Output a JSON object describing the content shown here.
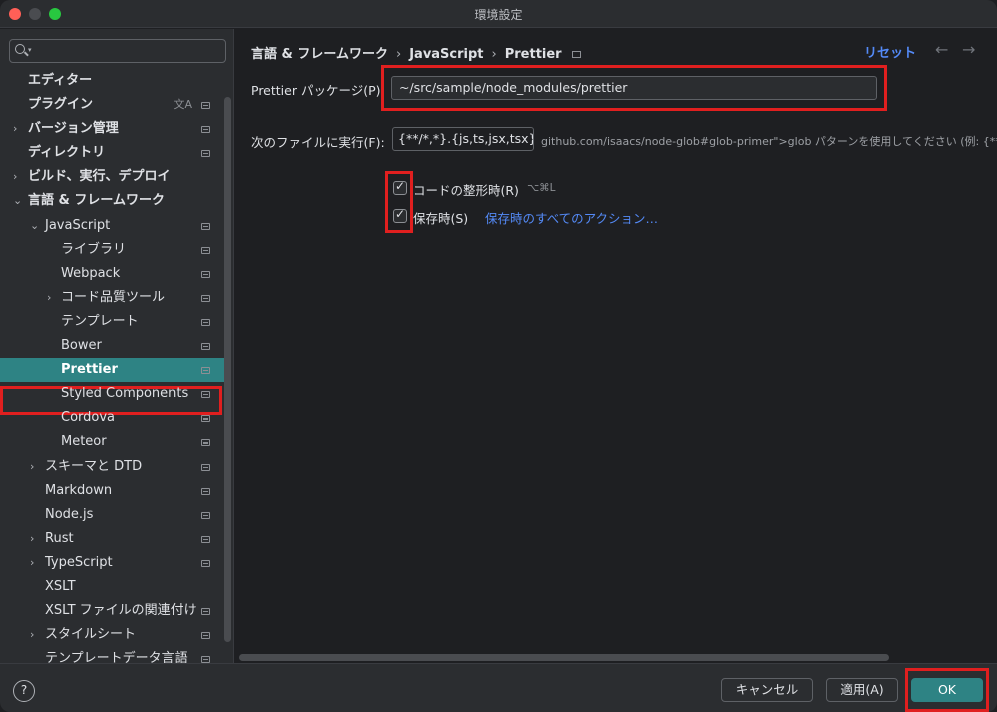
{
  "window": {
    "title": "環境設定"
  },
  "sidebar": {
    "search": {
      "placeholder": ""
    },
    "items": [
      {
        "label": "エディター",
        "indent": 0,
        "arrow": "",
        "bold": true,
        "icon": ""
      },
      {
        "label": "プラグイン",
        "indent": 0,
        "arrow": "",
        "bold": true,
        "icon": "project-icon",
        "lang_icon": "文A"
      },
      {
        "label": "バージョン管理",
        "indent": 0,
        "arrow": "›",
        "bold": true,
        "icon": "project-icon"
      },
      {
        "label": "ディレクトリ",
        "indent": 0,
        "arrow": "",
        "bold": true,
        "icon": "project-icon"
      },
      {
        "label": "ビルド、実行、デプロイ",
        "indent": 0,
        "arrow": "›",
        "bold": true,
        "icon": ""
      },
      {
        "label": "言語 & フレームワーク",
        "indent": 0,
        "arrow": "⌄",
        "bold": true,
        "icon": ""
      },
      {
        "label": "JavaScript",
        "indent": 1,
        "arrow": "⌄",
        "bold": false,
        "icon": "project-icon"
      },
      {
        "label": "ライブラリ",
        "indent": 2,
        "arrow": "",
        "bold": false,
        "icon": "project-icon"
      },
      {
        "label": "Webpack",
        "indent": 2,
        "arrow": "",
        "bold": false,
        "icon": "project-icon"
      },
      {
        "label": "コード品質ツール",
        "indent": 2,
        "arrow": "›",
        "bold": false,
        "icon": "project-icon"
      },
      {
        "label": "テンプレート",
        "indent": 2,
        "arrow": "",
        "bold": false,
        "icon": "project-icon"
      },
      {
        "label": "Bower",
        "indent": 2,
        "arrow": "",
        "bold": false,
        "icon": "project-icon"
      },
      {
        "label": "Prettier",
        "indent": 2,
        "arrow": "",
        "bold": false,
        "icon": "project-icon",
        "selected": true
      },
      {
        "label": "Styled Components",
        "indent": 2,
        "arrow": "",
        "bold": false,
        "icon": "project-icon"
      },
      {
        "label": "Cordova",
        "indent": 2,
        "arrow": "",
        "bold": false,
        "icon": "project-icon"
      },
      {
        "label": "Meteor",
        "indent": 2,
        "arrow": "",
        "bold": false,
        "icon": "project-icon"
      },
      {
        "label": "スキーマと DTD",
        "indent": 1,
        "arrow": "›",
        "bold": false,
        "icon": "project-icon"
      },
      {
        "label": "Markdown",
        "indent": 1,
        "arrow": "",
        "bold": false,
        "icon": "project-icon"
      },
      {
        "label": "Node.js",
        "indent": 1,
        "arrow": "",
        "bold": false,
        "icon": "project-icon"
      },
      {
        "label": "Rust",
        "indent": 1,
        "arrow": "›",
        "bold": false,
        "icon": "project-icon"
      },
      {
        "label": "TypeScript",
        "indent": 1,
        "arrow": "›",
        "bold": false,
        "icon": "project-icon"
      },
      {
        "label": "XSLT",
        "indent": 1,
        "arrow": "",
        "bold": false,
        "icon": ""
      },
      {
        "label": "XSLT ファイルの関連付け",
        "indent": 1,
        "arrow": "",
        "bold": false,
        "icon": "project-icon"
      },
      {
        "label": "スタイルシート",
        "indent": 1,
        "arrow": "›",
        "bold": false,
        "icon": "project-icon"
      },
      {
        "label": "テンプレートデータ言語",
        "indent": 1,
        "arrow": "",
        "bold": false,
        "icon": "project-icon"
      }
    ]
  },
  "main": {
    "breadcrumb": [
      "言語 & フレームワーク",
      "JavaScript",
      "Prettier"
    ],
    "reset_label": "リセット",
    "package": {
      "label": "Prettier パッケージ(P):",
      "value": "~/src/sample/node_modules/prettier"
    },
    "run_for": {
      "label": "次のファイルに実行(F):",
      "value": "{**/*,*}.{js,ts,jsx,tsx}",
      "hint": "github.com/isaacs/node-glob#glob-primer\">glob パターンを使用してください (例: {**/*,*}.{js,ts,jsx,tsx}"
    },
    "on_reformat": {
      "label": "コードの整形時(R)",
      "shortcut": "⌥⌘L",
      "checked": true
    },
    "on_save": {
      "label": "保存時(S)",
      "checked": true,
      "link": "保存時のすべてのアクション…"
    }
  },
  "footer": {
    "help": "?",
    "cancel": "キャンセル",
    "apply": "適用(A)",
    "ok": "OK"
  },
  "colors": {
    "accent": "#2e8384",
    "link": "#548af7",
    "highlight": "#e01f1f"
  }
}
